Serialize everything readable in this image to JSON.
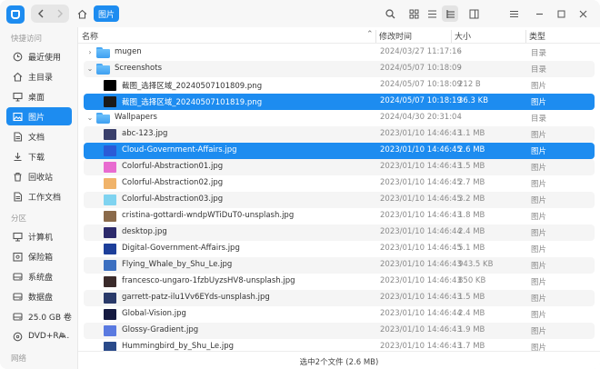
{
  "titlebar": {
    "breadcrumb_current": "图片"
  },
  "sidebar": {
    "sections": {
      "quick_access": "快捷访问",
      "partitions": "分区",
      "network": "网络"
    },
    "quick_items": [
      {
        "label": "最近使用",
        "icon": "clock-icon"
      },
      {
        "label": "主目录",
        "icon": "home-icon"
      },
      {
        "label": "桌面",
        "icon": "desktop-icon"
      },
      {
        "label": "图片",
        "icon": "picture-icon",
        "active": true
      },
      {
        "label": "文档",
        "icon": "document-icon"
      },
      {
        "label": "下载",
        "icon": "download-icon"
      },
      {
        "label": "回收站",
        "icon": "trash-icon"
      },
      {
        "label": "工作文档",
        "icon": "document-icon"
      }
    ],
    "partition_items": [
      {
        "label": "计算机",
        "icon": "computer-icon"
      },
      {
        "label": "保险箱",
        "icon": "vault-icon"
      },
      {
        "label": "系统盘",
        "icon": "disk-icon"
      },
      {
        "label": "数据盘",
        "icon": "disk-icon"
      },
      {
        "label": "25.0 GB 卷",
        "icon": "disk-icon"
      },
      {
        "label": "DVD+R/...",
        "icon": "optical-disc-icon"
      }
    ]
  },
  "columns": {
    "name": "名称",
    "modified": "修改时间",
    "size": "大小",
    "type": "类型"
  },
  "rows": [
    {
      "kind": "folder",
      "level": 0,
      "expander": "›",
      "name": "mugen",
      "modified": "2024/03/27 11:17:16",
      "size": "-",
      "type": "目录"
    },
    {
      "kind": "folder",
      "level": 0,
      "expander": "⌄",
      "name": "Screenshots",
      "modified": "2024/05/07 10:18:09",
      "size": "-",
      "type": "目录"
    },
    {
      "kind": "file",
      "level": 1,
      "name": "截图_选择区域_20240507101809.png",
      "modified": "2024/05/07 10:18:09",
      "size": "212 B",
      "type": "图片",
      "thumb": "#000000"
    },
    {
      "kind": "file",
      "level": 1,
      "name": "截图_选择区域_20240507101819.png",
      "modified": "2024/05/07 10:18:19",
      "size": "36.3 KB",
      "type": "图片",
      "thumb": "#1a1a1a",
      "selected": true
    },
    {
      "kind": "folder",
      "level": 0,
      "expander": "⌄",
      "name": "Wallpapers",
      "modified": "2024/04/30 20:31:04",
      "size": "-",
      "type": "目录"
    },
    {
      "kind": "file",
      "level": 1,
      "name": "abc-123.jpg",
      "modified": "2023/01/10 14:46:43",
      "size": "1.1 MB",
      "type": "图片",
      "thumb": "#3a3f6b"
    },
    {
      "kind": "file",
      "level": 1,
      "name": "Cloud-Government-Affairs.jpg",
      "modified": "2023/01/10 14:46:45",
      "size": "2.6 MB",
      "type": "图片",
      "thumb": "#2a5bd7",
      "selected": true
    },
    {
      "kind": "file",
      "level": 1,
      "name": "Colorful-Abstraction01.jpg",
      "modified": "2023/01/10 14:46:43",
      "size": "1.5 MB",
      "type": "图片",
      "thumb": "#e86bd0"
    },
    {
      "kind": "file",
      "level": 1,
      "name": "Colorful-Abstraction02.jpg",
      "modified": "2023/01/10 14:46:45",
      "size": "2.7 MB",
      "type": "图片",
      "thumb": "#f0b36a"
    },
    {
      "kind": "file",
      "level": 1,
      "name": "Colorful-Abstraction03.jpg",
      "modified": "2023/01/10 14:46:45",
      "size": "3.2 MB",
      "type": "图片",
      "thumb": "#7fd3f0"
    },
    {
      "kind": "file",
      "level": 1,
      "name": "cristina-gottardi-wndpWTiDuT0-unsplash.jpg",
      "modified": "2023/01/10 14:46:43",
      "size": "1.8 MB",
      "type": "图片",
      "thumb": "#8a6a4a"
    },
    {
      "kind": "file",
      "level": 1,
      "name": "desktop.jpg",
      "modified": "2023/01/10 14:46:44",
      "size": "2.4 MB",
      "type": "图片",
      "thumb": "#2c2a6b"
    },
    {
      "kind": "file",
      "level": 1,
      "name": "Digital-Government-Affairs.jpg",
      "modified": "2023/01/10 14:46:45",
      "size": "5.1 MB",
      "type": "图片",
      "thumb": "#1d3f9a"
    },
    {
      "kind": "file",
      "level": 1,
      "name": "Flying_Whale_by_Shu_Le.jpg",
      "modified": "2023/01/10 14:46:43",
      "size": "943.5 KB",
      "type": "图片",
      "thumb": "#3b6fc0"
    },
    {
      "kind": "file",
      "level": 1,
      "name": "francesco-ungaro-1fzbUyzsHV8-unsplash.jpg",
      "modified": "2023/01/10 14:46:43",
      "size": "850 KB",
      "type": "图片",
      "thumb": "#3a2a2a"
    },
    {
      "kind": "file",
      "level": 1,
      "name": "garrett-patz-ilu1Vv6EYds-unsplash.jpg",
      "modified": "2023/01/10 14:46:43",
      "size": "1.5 MB",
      "type": "图片",
      "thumb": "#2a3a6a"
    },
    {
      "kind": "file",
      "level": 1,
      "name": "Global-Vision.jpg",
      "modified": "2023/01/10 14:46:44",
      "size": "2.4 MB",
      "type": "图片",
      "thumb": "#141a40"
    },
    {
      "kind": "file",
      "level": 1,
      "name": "Glossy-Gradient.jpg",
      "modified": "2023/01/10 14:46:43",
      "size": "1.9 MB",
      "type": "图片",
      "thumb": "#5a7ae0"
    },
    {
      "kind": "file",
      "level": 1,
      "name": "Hummingbird_by_Shu_Le.jpg",
      "modified": "2023/01/10 14:46:43",
      "size": "1.7 MB",
      "type": "图片",
      "thumb": "#2a4a8a"
    }
  ],
  "status": {
    "text": "选中2个文件 (2.6 MB)"
  },
  "colors": {
    "accent": "#1d8cf0"
  }
}
